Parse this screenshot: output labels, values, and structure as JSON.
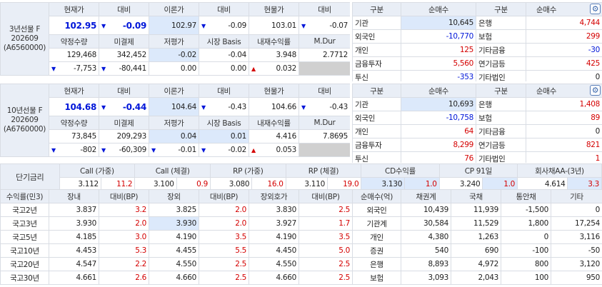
{
  "futures": [
    {
      "label": "3년선물 F 202609 (A6560000)",
      "h1": [
        "현재가",
        "대비",
        "이론가",
        "대비",
        "현물가",
        "대비"
      ],
      "r1": {
        "cur": "102.95",
        "cur_chg": "-0.09",
        "theo": "102.97",
        "theo_chg": "-0.09",
        "spot": "103.01",
        "spot_chg": "-0.07"
      },
      "h2": [
        "약정수량",
        "미결제",
        "저평가",
        "시장 Basis",
        "내재수익률",
        "M.Dur"
      ],
      "r2": [
        "129,468",
        "342,452",
        "-0.02",
        "-0.04",
        "3.948",
        "2.7712"
      ],
      "r3": [
        "-7,753",
        "-80,441",
        "0.00",
        "0.00",
        "0.032",
        ""
      ]
    },
    {
      "label": "10년선물 F 202609 (A6760000)",
      "h1": [
        "현재가",
        "대비",
        "이론가",
        "대비",
        "현물가",
        "대비"
      ],
      "r1": {
        "cur": "104.68",
        "cur_chg": "-0.44",
        "theo": "104.64",
        "theo_chg": "-0.43",
        "spot": "104.66",
        "spot_chg": "-0.43"
      },
      "h2": [
        "약정수량",
        "미결제",
        "저평가",
        "시장 Basis",
        "내재수익률",
        "M.Dur"
      ],
      "r2": [
        "73,845",
        "209,293",
        "0.04",
        "0.01",
        "4.416",
        "7.8695"
      ],
      "r3": [
        "-802",
        "-60,309",
        "-0.01",
        "-0.02",
        "0.053",
        ""
      ]
    }
  ],
  "investors": [
    {
      "header": [
        "구분",
        "순매수",
        "구분",
        "순매수"
      ],
      "rows": [
        [
          "기관",
          "10,645",
          "은행",
          "4,744"
        ],
        [
          "외국인",
          "-10,770",
          "보험",
          "299"
        ],
        [
          "개인",
          "125",
          "기타금융",
          "-30"
        ],
        [
          "금융투자",
          "5,560",
          "연기금등",
          "425"
        ],
        [
          "투신",
          "-353",
          "기타법인",
          "0"
        ]
      ]
    },
    {
      "header": [
        "구분",
        "순매수",
        "구분",
        "순매수"
      ],
      "rows": [
        [
          "기관",
          "10,693",
          "은행",
          "1,408"
        ],
        [
          "외국인",
          "-10,758",
          "보험",
          "89"
        ],
        [
          "개인",
          "64",
          "기타금융",
          "0"
        ],
        [
          "금융투자",
          "8,299",
          "연기금등",
          "821"
        ],
        [
          "투신",
          "76",
          "기타법인",
          "1"
        ]
      ]
    }
  ],
  "short_rates": {
    "label": "단기금리",
    "headers": [
      "Call (가중)",
      "Call (체결)",
      "RP (가중)",
      "RP (체결)",
      "CD수익률",
      "CP 91일",
      "회사채AA-(3년)"
    ],
    "values": [
      [
        "3.112",
        "11.2"
      ],
      [
        "3.100",
        "0.9"
      ],
      [
        "3.080",
        "16.0"
      ],
      [
        "3.110",
        "19.0"
      ],
      [
        "3.130",
        "1.0"
      ],
      [
        "3.240",
        "1.0"
      ],
      [
        "4.614",
        "3.3"
      ]
    ]
  },
  "yields": {
    "header": [
      "수익률(민3)",
      "장내",
      "대비(BP)",
      "장외",
      "대비(BP)",
      "장외호가",
      "대비(BP)"
    ],
    "rows": [
      [
        "국고2년",
        "3.837",
        "3.2",
        "3.825",
        "2.0",
        "3.830",
        "2.5"
      ],
      [
        "국고3년",
        "3.930",
        "2.0",
        "3.930",
        "2.0",
        "3.927",
        "1.7"
      ],
      [
        "국고5년",
        "4.185",
        "3.0",
        "4.190",
        "3.5",
        "4.190",
        "3.5"
      ],
      [
        "국고10년",
        "4.453",
        "5.3",
        "4.455",
        "5.5",
        "4.450",
        "5.0"
      ],
      [
        "국고20년",
        "4.547",
        "2.2",
        "4.550",
        "2.5",
        "4.550",
        "2.5"
      ],
      [
        "국고30년",
        "4.661",
        "2.6",
        "4.660",
        "2.5",
        "4.660",
        "2.5"
      ]
    ]
  },
  "bond_net": {
    "header": [
      "순매수(억)",
      "채권계",
      "국채",
      "통안채",
      "기타"
    ],
    "rows": [
      [
        "외국인",
        "10,439",
        "11,939",
        "-1,500",
        "0"
      ],
      [
        "기관계",
        "30,584",
        "11,529",
        "1,800",
        "17,254"
      ],
      [
        "개인",
        "4,380",
        "1,263",
        "0",
        "3,116"
      ],
      [
        "증권",
        "540",
        "690",
        "-100",
        "-50"
      ],
      [
        "은행",
        "8,893",
        "4,972",
        "800",
        "3,120"
      ],
      [
        "보험",
        "3,093",
        "2,043",
        "100",
        "950"
      ]
    ]
  },
  "colors": {
    "up": "#d40000",
    "down": "#0016d9",
    "header_bg": "#e9eef6",
    "highlight": "#dce9fb"
  },
  "icons": {
    "settings": "gear-icon",
    "down": "triangle-down-icon",
    "up": "triangle-up-icon"
  }
}
